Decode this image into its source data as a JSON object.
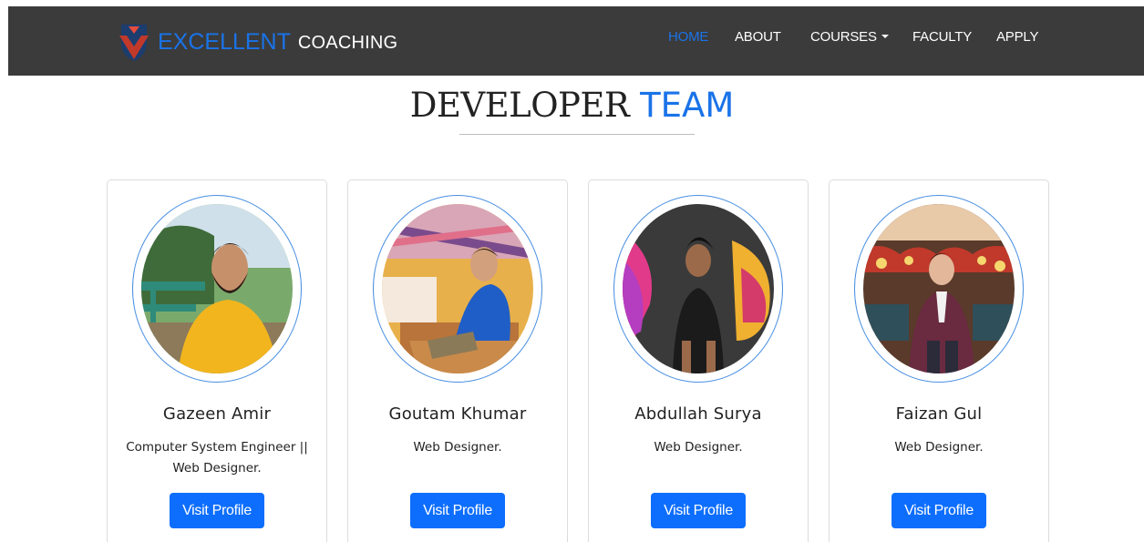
{
  "brand": {
    "part1": "EXCELLENT",
    "part2": "COACHING",
    "logo_icon": "shield-logo-icon"
  },
  "nav": {
    "home": "HOME",
    "about": "ABOUT",
    "courses": "COURSES",
    "faculty": "FACULTY",
    "apply": "APPLY",
    "active": "home"
  },
  "heading": {
    "part1": "DEVELOPER",
    "part2": "TEAM"
  },
  "colors": {
    "accent": "#1a73e8",
    "navbar": "#3b3b3b",
    "button": "#0d6efd",
    "ring": "#4a90e2"
  },
  "team": [
    {
      "name": "Gazeen Amir",
      "role": "Computer System Engineer || Web Designer.",
      "button": "Visit Profile"
    },
    {
      "name": "Goutam Khumar",
      "role": "Web Designer.",
      "button": "Visit Profile"
    },
    {
      "name": "Abdullah Surya",
      "role": "Web Designer.",
      "button": "Visit Profile"
    },
    {
      "name": "Faizan Gul",
      "role": "Web Designer.",
      "button": "Visit Profile"
    }
  ]
}
